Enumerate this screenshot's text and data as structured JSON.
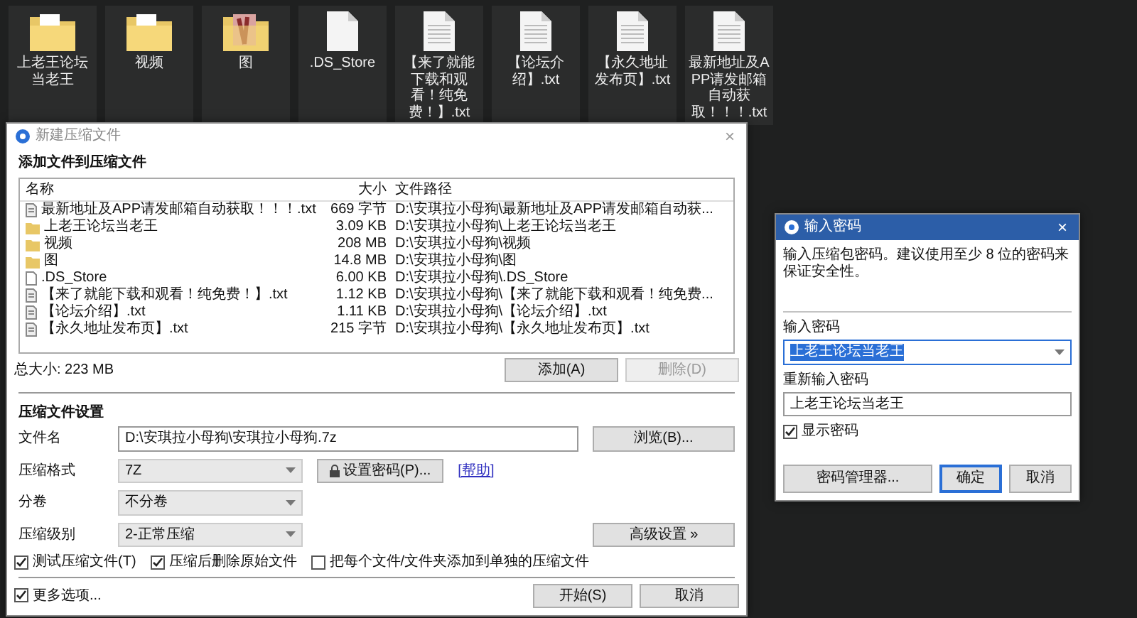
{
  "desktop": [
    {
      "kind": "folder",
      "label": "上老王论坛当老王"
    },
    {
      "kind": "folder",
      "label": "视频"
    },
    {
      "kind": "picture-folder",
      "label": "图"
    },
    {
      "kind": "file",
      "label": ".DS_Store"
    },
    {
      "kind": "txt",
      "label": "【来了就能下载和观看！纯免费！】.txt"
    },
    {
      "kind": "txt",
      "label": "【论坛介绍】.txt"
    },
    {
      "kind": "txt",
      "label": "【永久地址发布页】.txt"
    },
    {
      "kind": "txt",
      "label": "最新地址及APP请发邮箱自动获取！！！.txt"
    }
  ],
  "archive_dialog": {
    "title": "新建压缩文件",
    "close": "×",
    "section_files": "添加文件到压缩文件",
    "columns": [
      "名称",
      "大小",
      "文件路径"
    ],
    "rows": [
      {
        "kind": "txt",
        "name": "最新地址及APP请发邮箱自动获取！！！.txt",
        "size": "669 字节",
        "path": "D:\\安琪拉小母狗\\最新地址及APP请发邮箱自动获..."
      },
      {
        "kind": "folder",
        "name": "上老王论坛当老王",
        "size": "3.09 KB",
        "path": "D:\\安琪拉小母狗\\上老王论坛当老王"
      },
      {
        "kind": "folder",
        "name": "视频",
        "size": "208 MB",
        "path": "D:\\安琪拉小母狗\\视频"
      },
      {
        "kind": "folder",
        "name": "图",
        "size": "14.8 MB",
        "path": "D:\\安琪拉小母狗\\图"
      },
      {
        "kind": "file",
        "name": ".DS_Store",
        "size": "6.00 KB",
        "path": "D:\\安琪拉小母狗\\.DS_Store"
      },
      {
        "kind": "txt",
        "name": "【来了就能下载和观看！纯免费！】.txt",
        "size": "1.12 KB",
        "path": "D:\\安琪拉小母狗\\【来了就能下载和观看！纯免费..."
      },
      {
        "kind": "txt",
        "name": "【论坛介绍】.txt",
        "size": "1.11 KB",
        "path": "D:\\安琪拉小母狗\\【论坛介绍】.txt"
      },
      {
        "kind": "txt",
        "name": "【永久地址发布页】.txt",
        "size": "215 字节",
        "path": "D:\\安琪拉小母狗\\【永久地址发布页】.txt"
      }
    ],
    "total": "总大小: 223 MB",
    "list_buttons": [
      {
        "label": "添加(A)",
        "disabled": false
      },
      {
        "label": "删除(D)",
        "disabled": true
      }
    ],
    "section_settings": "压缩文件设置",
    "filename_label": "文件名",
    "filename": "D:\\安琪拉小母狗\\安琪拉小母狗.7z",
    "browse": "浏览(B)...",
    "format_label": "压缩格式",
    "format": "7Z",
    "password_button": "设置密码(P)...",
    "help_link": "[帮助]",
    "split_label": "分卷",
    "split": "不分卷",
    "level_label": "压缩级别",
    "level_value": "2-正常压缩",
    "advanced": "高级设置 »",
    "options": [
      {
        "label": "测试压缩文件(T)",
        "checked": true
      },
      {
        "label": "压缩后删除原始文件",
        "checked": true
      },
      {
        "label": "把每个文件/文件夹添加到单独的压缩文件",
        "checked": false
      }
    ],
    "more_options": {
      "label": "更多选项...",
      "checked": true
    },
    "buttons": [
      "开始(S)",
      "取消"
    ]
  },
  "password_dialog": {
    "title": "输入密码",
    "close": "×",
    "hint": "输入压缩包密码。建议使用至少 8 位的密码来保证安全性。",
    "password_label": "输入密码",
    "password": "上老王论坛当老王",
    "password_highlighted": true,
    "repeat_label": "重新输入密码",
    "repeat": "上老王论坛当老王",
    "show_password": {
      "label": "显示密码",
      "checked": true
    },
    "manager_button": "密码管理器...",
    "buttons": [
      {
        "label": "确定",
        "default": true
      },
      {
        "label": "取消",
        "default": false
      }
    ]
  }
}
